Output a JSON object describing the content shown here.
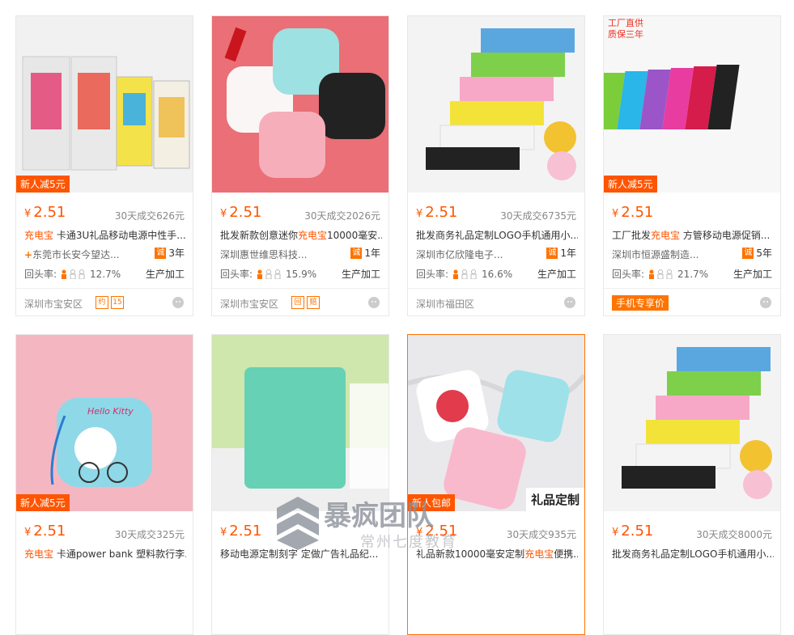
{
  "colors": {
    "accent": "#ff5500",
    "orange": "#ff7300"
  },
  "cards": [
    {
      "price": "2.51",
      "currency": "¥",
      "sales": "30天成交626元",
      "title_kw": "充电宝",
      "title_rest": " 卡通3U礼品移动电源中性手...",
      "company": "东莞市长安今望达...",
      "years": "3年",
      "rate_label": "回头率:",
      "rate": "12.7%",
      "mode": "生产加工",
      "location": "深圳市宝安区",
      "promo": "新人减5元",
      "badges": [
        "约",
        "15"
      ]
    },
    {
      "price": "2.51",
      "currency": "¥",
      "sales": "30天成交2026元",
      "title_pre": "批发新款创意迷你",
      "title_kw": "充电宝",
      "title_rest": "10000毫安...",
      "company": "深圳惠世维思科技...",
      "years": "1年",
      "rate_label": "回头率:",
      "rate": "15.9%",
      "mode": "生产加工",
      "location": "深圳市宝安区",
      "badges": [
        "回",
        "赔"
      ]
    },
    {
      "price": "2.51",
      "currency": "¥",
      "sales": "30天成交6735元",
      "title_rest": "批发商务礼品定制LOGO手机通用小...",
      "company": "深圳市亿欣隆电子...",
      "years": "1年",
      "rate_label": "回头率:",
      "rate": "16.6%",
      "mode": "生产加工",
      "location": "深圳市福田区"
    },
    {
      "price": "2.51",
      "currency": "¥",
      "sales": "",
      "title_pre": "工厂批发",
      "title_kw": "充电宝",
      "title_rest": " 方管移动电源促销...",
      "company": "深圳市恒源盛制造...",
      "years": "5年",
      "rate_label": "回头率:",
      "rate": "21.7%",
      "mode": "生产加工",
      "promo": "新人减5元",
      "mobile_price": "手机专享价",
      "img_tag1": "工厂直供",
      "img_tag2": "质保三年"
    },
    {
      "price": "2.51",
      "currency": "¥",
      "sales": "30天成交325元",
      "title_kw": "充电宝",
      "title_rest": " 卡通power bank 塑料款行李...",
      "promo": "新人减5元",
      "img_text": "Hello Kitty"
    },
    {
      "price": "2.51",
      "currency": "¥",
      "sales": "",
      "title_rest": "移动电源定制刻字 定做广告礼品纪..."
    },
    {
      "price": "2.51",
      "currency": "¥",
      "sales": "30天成交935元",
      "title_rest": "礼品新款10000毫安定制",
      "title_kw": "充电宝",
      "title_rest2": "便携...",
      "promo": "新人包邮",
      "img_label": "礼品定制"
    },
    {
      "price": "2.51",
      "currency": "¥",
      "sales": "30天成交8000元",
      "title_rest": "批发商务礼品定制LOGO手机通用小..."
    }
  ],
  "watermark": {
    "title": "暴疯团队",
    "subtitle": "常州七度教育"
  }
}
